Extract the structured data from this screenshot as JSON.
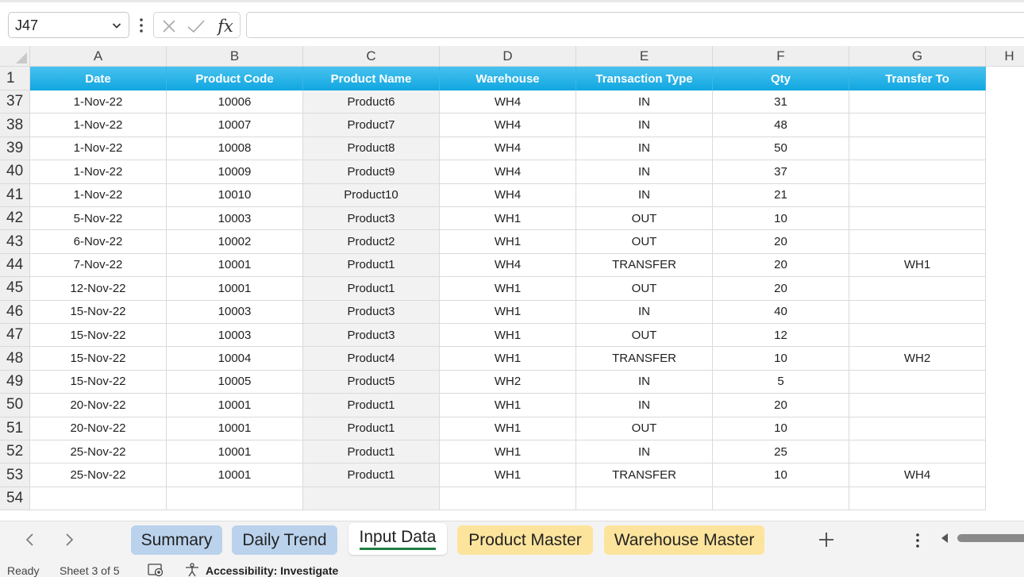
{
  "formula_bar": {
    "name_box": "J47",
    "fx_label": "fx",
    "formula": ""
  },
  "columns": [
    "A",
    "B",
    "C",
    "D",
    "E",
    "F",
    "G",
    "H"
  ],
  "headers": [
    "Date",
    "Product Code",
    "Product Name",
    "Warehouse",
    "Transaction Type",
    "Qty",
    "Transfer To"
  ],
  "header_row_number": "1",
  "rows": [
    {
      "n": "37",
      "cells": [
        "1-Nov-22",
        "10006",
        "Product6",
        "WH4",
        "IN",
        "31",
        ""
      ]
    },
    {
      "n": "38",
      "cells": [
        "1-Nov-22",
        "10007",
        "Product7",
        "WH4",
        "IN",
        "48",
        ""
      ]
    },
    {
      "n": "39",
      "cells": [
        "1-Nov-22",
        "10008",
        "Product8",
        "WH4",
        "IN",
        "50",
        ""
      ]
    },
    {
      "n": "40",
      "cells": [
        "1-Nov-22",
        "10009",
        "Product9",
        "WH4",
        "IN",
        "37",
        ""
      ]
    },
    {
      "n": "41",
      "cells": [
        "1-Nov-22",
        "10010",
        "Product10",
        "WH4",
        "IN",
        "21",
        ""
      ]
    },
    {
      "n": "42",
      "cells": [
        "5-Nov-22",
        "10003",
        "Product3",
        "WH1",
        "OUT",
        "10",
        ""
      ]
    },
    {
      "n": "43",
      "cells": [
        "6-Nov-22",
        "10002",
        "Product2",
        "WH1",
        "OUT",
        "20",
        ""
      ]
    },
    {
      "n": "44",
      "cells": [
        "7-Nov-22",
        "10001",
        "Product1",
        "WH4",
        "TRANSFER",
        "20",
        "WH1"
      ]
    },
    {
      "n": "45",
      "cells": [
        "12-Nov-22",
        "10001",
        "Product1",
        "WH1",
        "OUT",
        "20",
        ""
      ]
    },
    {
      "n": "46",
      "cells": [
        "15-Nov-22",
        "10003",
        "Product3",
        "WH1",
        "IN",
        "40",
        ""
      ]
    },
    {
      "n": "47",
      "cells": [
        "15-Nov-22",
        "10003",
        "Product3",
        "WH1",
        "OUT",
        "12",
        ""
      ]
    },
    {
      "n": "48",
      "cells": [
        "15-Nov-22",
        "10004",
        "Product4",
        "WH1",
        "TRANSFER",
        "10",
        "WH2"
      ]
    },
    {
      "n": "49",
      "cells": [
        "15-Nov-22",
        "10005",
        "Product5",
        "WH2",
        "IN",
        "5",
        ""
      ]
    },
    {
      "n": "50",
      "cells": [
        "20-Nov-22",
        "10001",
        "Product1",
        "WH1",
        "IN",
        "20",
        ""
      ]
    },
    {
      "n": "51",
      "cells": [
        "20-Nov-22",
        "10001",
        "Product1",
        "WH1",
        "OUT",
        "10",
        ""
      ]
    },
    {
      "n": "52",
      "cells": [
        "25-Nov-22",
        "10001",
        "Product1",
        "WH1",
        "IN",
        "25",
        ""
      ]
    },
    {
      "n": "53",
      "cells": [
        "25-Nov-22",
        "10001",
        "Product1",
        "WH1",
        "TRANSFER",
        "10",
        "WH4"
      ]
    },
    {
      "n": "54",
      "cells": [
        "",
        "",
        "",
        "",
        "",
        "",
        ""
      ]
    }
  ],
  "sheet_tabs": [
    {
      "label": "Summary",
      "color": "#bad2ec",
      "active": false
    },
    {
      "label": "Daily Trend",
      "color": "#bad2ec",
      "active": false
    },
    {
      "label": "Input Data",
      "color": "#ffffff",
      "active": true
    },
    {
      "label": "Product Master",
      "color": "#fde49c",
      "active": false
    },
    {
      "label": "Warehouse Master",
      "color": "#fde49c",
      "active": false
    }
  ],
  "status_bar": {
    "ready": "Ready",
    "sheet_info": "Sheet 3 of 5",
    "accessibility": "Accessibility: Investigate"
  },
  "colors": {
    "header_fill": "#10a6e0",
    "header_text": "#ffffff",
    "active_tab_underline": "#1e7f3f"
  },
  "icons": [
    "chevron-down-icon",
    "more-options-icon",
    "cancel-x-icon",
    "confirm-check-icon",
    "insert-function-icon",
    "scroll-left-icon",
    "scroll-right-icon",
    "add-sheet-icon",
    "macro-record-icon",
    "accessibility-icon"
  ]
}
